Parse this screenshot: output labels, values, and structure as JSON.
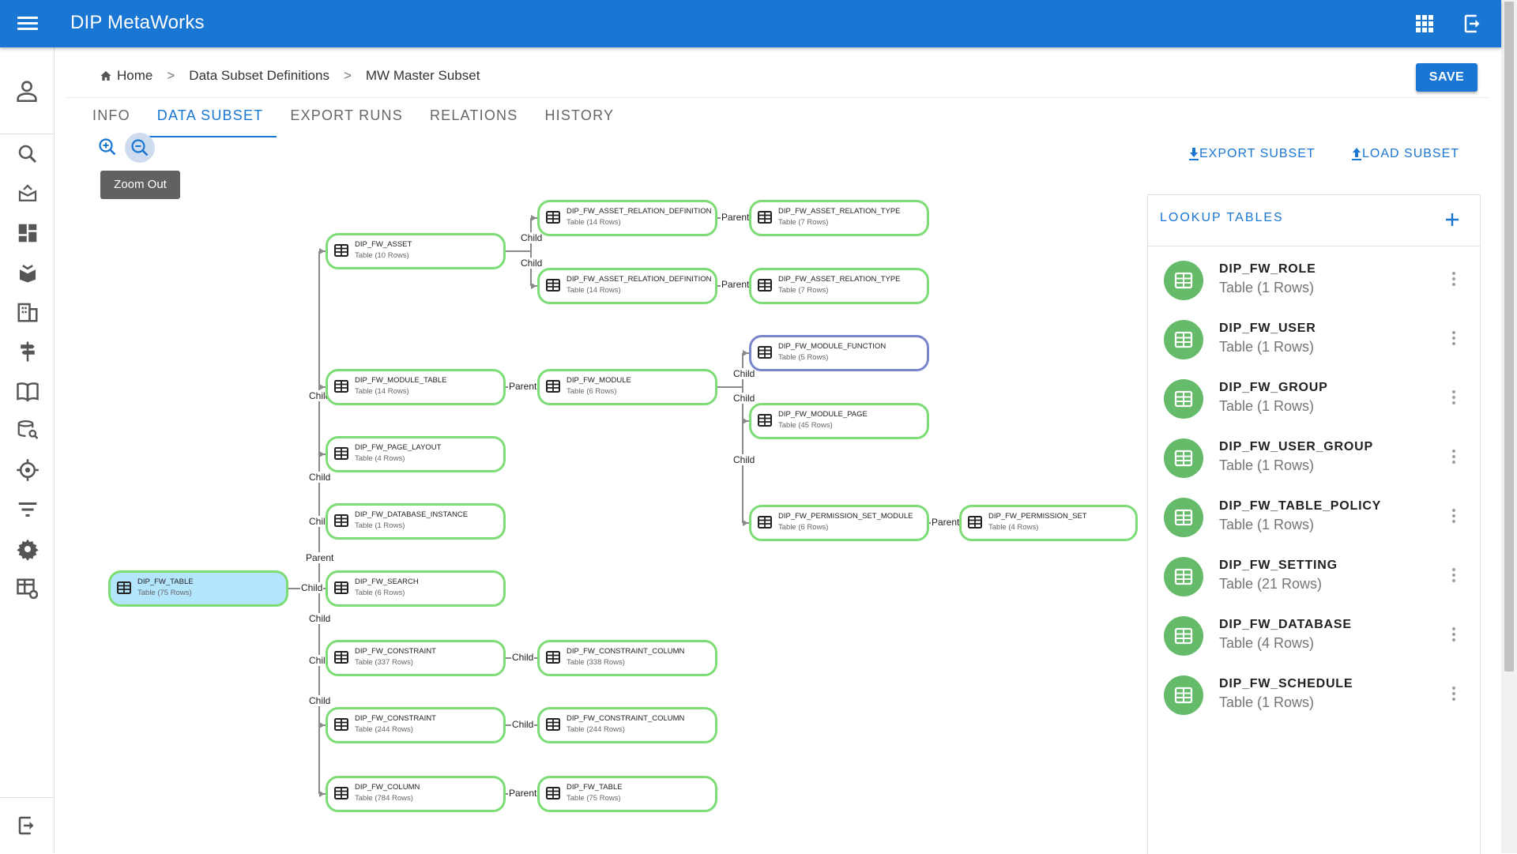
{
  "app": {
    "title": "DIP MetaWorks"
  },
  "breadcrumb": {
    "home": "Home",
    "sep1": ">",
    "defs": "Data Subset Definitions",
    "sep2": ">",
    "current": "MW Master Subset"
  },
  "actions": {
    "save": "SAVE",
    "export_subset": "EXPORT SUBSET",
    "load_subset": "LOAD SUBSET"
  },
  "tabs": [
    {
      "label": "INFO"
    },
    {
      "label": "DATA SUBSET"
    },
    {
      "label": "EXPORT RUNS"
    },
    {
      "label": "RELATIONS"
    },
    {
      "label": "HISTORY"
    }
  ],
  "active_tab": "DATA SUBSET",
  "tooltip": "Zoom Out",
  "graph": {
    "nodes": [
      {
        "name": "DIP_FW_TABLE",
        "rows": "Table (75 Rows)",
        "selected": true
      },
      {
        "name": "DIP_FW_ASSET",
        "rows": "Table (10 Rows)"
      },
      {
        "name": "DIP_FW_ASSET_RELATION_DEFINITION",
        "rows": "Table (14 Rows)"
      },
      {
        "name": "DIP_FW_ASSET_RELATION_TYPE",
        "rows": "Table (7 Rows)"
      },
      {
        "name": "DIP_FW_ASSET_RELATION_DEFINITION",
        "rows": "Table (14 Rows)"
      },
      {
        "name": "DIP_FW_ASSET_RELATION_TYPE",
        "rows": "Table (7 Rows)"
      },
      {
        "name": "DIP_FW_MODULE_FUNCTION",
        "rows": "Table (5 Rows)",
        "variant": "blue"
      },
      {
        "name": "DIP_FW_MODULE_TABLE",
        "rows": "Table (14 Rows)"
      },
      {
        "name": "DIP_FW_MODULE",
        "rows": "Table (6 Rows)"
      },
      {
        "name": "DIP_FW_MODULE_PAGE",
        "rows": "Table (45 Rows)"
      },
      {
        "name": "DIP_FW_PAGE_LAYOUT",
        "rows": "Table (4 Rows)"
      },
      {
        "name": "DIP_FW_DATABASE_INSTANCE",
        "rows": "Table (1 Rows)"
      },
      {
        "name": "DIP_FW_PERMISSION_SET_MODULE",
        "rows": "Table (6 Rows)"
      },
      {
        "name": "DIP_FW_PERMISSION_SET",
        "rows": "Table (4 Rows)"
      },
      {
        "name": "DIP_FW_SEARCH",
        "rows": "Table (6 Rows)"
      },
      {
        "name": "DIP_FW_CONSTRAINT",
        "rows": "Table (337 Rows)"
      },
      {
        "name": "DIP_FW_CONSTRAINT_COLUMN",
        "rows": "Table (338 Rows)"
      },
      {
        "name": "DIP_FW_CONSTRAINT",
        "rows": "Table (244 Rows)"
      },
      {
        "name": "DIP_FW_CONSTRAINT_COLUMN",
        "rows": "Table (244 Rows)"
      },
      {
        "name": "DIP_FW_COLUMN",
        "rows": "Table (784 Rows)"
      },
      {
        "name": "DIP_FW_TABLE",
        "rows": "Table (75 Rows)"
      }
    ],
    "edge_labels": [
      "Child",
      "Child",
      "Parent",
      "Parent",
      "Child",
      "Child",
      "Child",
      "Parent",
      "Child",
      "Child",
      "Parent",
      "Parent",
      "Child",
      "Child",
      "Child",
      "Child",
      "Child",
      "Child",
      "Child",
      "Parent"
    ]
  },
  "lookup": {
    "title": "LOOKUP TABLES",
    "items": [
      {
        "name": "DIP_FW_ROLE",
        "sub": "Table (1 Rows)"
      },
      {
        "name": "DIP_FW_USER",
        "sub": "Table (1 Rows)"
      },
      {
        "name": "DIP_FW_GROUP",
        "sub": "Table (1 Rows)"
      },
      {
        "name": "DIP_FW_USER_GROUP",
        "sub": "Table (1 Rows)"
      },
      {
        "name": "DIP_FW_TABLE_POLICY",
        "sub": "Table (1 Rows)"
      },
      {
        "name": "DIP_FW_SETTING",
        "sub": "Table (21 Rows)"
      },
      {
        "name": "DIP_FW_DATABASE",
        "sub": "Table (4 Rows)"
      },
      {
        "name": "DIP_FW_SCHEDULE",
        "sub": "Table (1 Rows)"
      }
    ]
  },
  "colors": {
    "primary": "#1976d2",
    "node_border": "#7ddc76",
    "node_selected": "#b3e5fc",
    "lookup_avatar": "#66bb6a"
  }
}
